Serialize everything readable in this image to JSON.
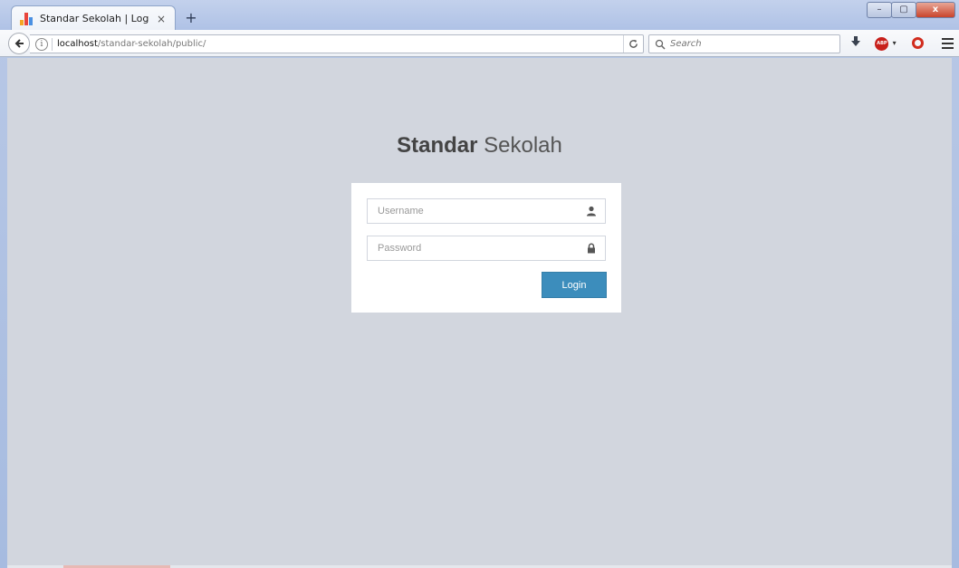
{
  "browser": {
    "tab": {
      "title": "Standar Sekolah | Login",
      "favicon": "bar-chart-favicon",
      "close_glyph": "×"
    },
    "new_tab_glyph": "+",
    "window_controls": {
      "minimize": "–",
      "maximize": "▢",
      "close": "x"
    },
    "url": {
      "host": "localhost",
      "path": "/standar-sekolah/public/"
    },
    "search": {
      "placeholder": "Search"
    },
    "icons": {
      "back": "back-arrow-icon",
      "info": "info-icon",
      "reload": "reload-icon",
      "download": "download-icon",
      "adblock": "adblock-plus-icon",
      "opera": "opera-icon",
      "menu": "hamburger-menu-icon"
    },
    "adblock_badge": "ABP"
  },
  "login": {
    "logo_bold": "Standar",
    "logo_light": " Sekolah",
    "username_placeholder": "Username",
    "password_placeholder": "Password",
    "login_label": "Login"
  },
  "colors": {
    "page_background": "#d2d6de",
    "primary_button": "#3c8dbc",
    "box_background": "#ffffff"
  }
}
